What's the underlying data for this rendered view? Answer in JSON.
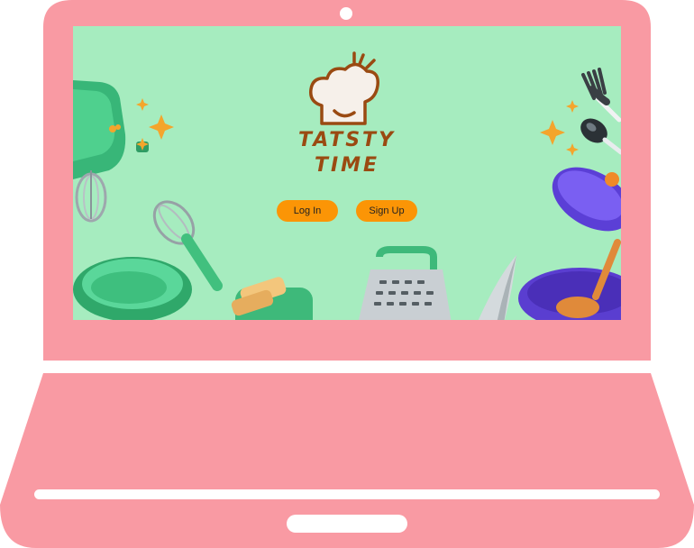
{
  "app": {
    "brand_line1": "TATSTY",
    "brand_line2": "TIME"
  },
  "auth": {
    "login_label": "Log In",
    "signup_label": "Sign Up"
  },
  "colors": {
    "device_frame": "#f99aa3",
    "screen_background": "#a6ecbf",
    "button_background": "#fb9506",
    "logo_brown": "#9a4a12"
  }
}
